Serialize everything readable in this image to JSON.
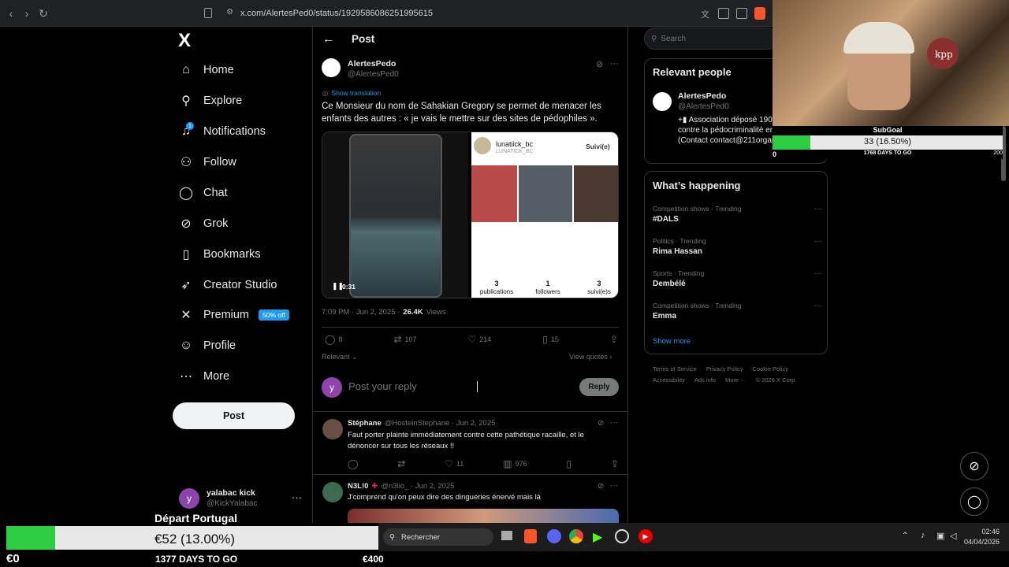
{
  "browser": {
    "url": "x.com/AlertesPed0/status/1929586086251995615"
  },
  "sidebar": {
    "logo": "X",
    "items": [
      {
        "label": "Home",
        "icon": "home-icon",
        "glyph": "⌂"
      },
      {
        "label": "Explore",
        "icon": "search-icon",
        "glyph": "⚲"
      },
      {
        "label": "Notifications",
        "icon": "bell-icon",
        "glyph": "♫"
      },
      {
        "label": "Follow",
        "icon": "add-person-icon",
        "glyph": "⚇"
      },
      {
        "label": "Chat",
        "icon": "chat-icon",
        "glyph": "◯"
      },
      {
        "label": "Grok",
        "icon": "grok-icon",
        "glyph": "⊘"
      },
      {
        "label": "Bookmarks",
        "icon": "bookmark-icon",
        "glyph": "▯"
      },
      {
        "label": "Creator Studio",
        "icon": "rocket-icon",
        "glyph": "➶"
      },
      {
        "label": "Premium",
        "icon": "x-icon",
        "glyph": "✕"
      },
      {
        "label": "Profile",
        "icon": "person-icon",
        "glyph": "☺"
      },
      {
        "label": "More",
        "icon": "more-circle-icon",
        "glyph": "⋯"
      }
    ],
    "notifications_badge": "1",
    "premium_badge": "50% off",
    "post_button": "Post",
    "account": {
      "avatar_letter": "y",
      "name": "yalabac kick",
      "handle": "@KickYalabac"
    }
  },
  "main": {
    "header_title": "Post",
    "post": {
      "author_name": "AlertesPedo",
      "author_handle": "@AlertesPed0",
      "show_translation": "Show translation",
      "text": "Ce Monsieur du nom de Sahakian Gregory se permet de menacer les enfants des autres : « je vais le mettre sur des sites de pédophiles ».",
      "video_time": "0:31",
      "profile_shot": {
        "name": "lunatiick_bc",
        "handle": "LUNATICK_BC",
        "button": "Suivi(e)",
        "stats": [
          {
            "value": "3",
            "label": "publications"
          },
          {
            "value": "1",
            "label": "followers"
          },
          {
            "value": "3",
            "label": "suivi(e)s"
          }
        ]
      },
      "timestamp": "7:09 PM · Jun 2, 2025 ·",
      "views_count": "26.4K",
      "views_label": "Views",
      "replies": "8",
      "reposts": "107",
      "likes": "214",
      "bookmarks": "15",
      "sort_label": "Relevant",
      "view_quotes": "View quotes"
    },
    "reply_box": {
      "avatar_letter": "y",
      "placeholder": "Post your reply",
      "button": "Reply"
    },
    "replies": [
      {
        "name": "Stéphane",
        "handle": "@HosteinStephane · Jun 2, 2025",
        "text": "Faut porter plainte immédiatement contre cette pathétique racaille, et le dénoncer sur tous les réseaux !!",
        "likes": "11",
        "views": "976"
      },
      {
        "name": "N3L!0",
        "handle": "@n3lio_ · Jun 2, 2025",
        "text": "J'comprend qu'on peux dire des dingueries énervé mais là"
      }
    ]
  },
  "right": {
    "search_placeholder": "Search",
    "relevant": {
      "title": "Relevant people",
      "name": "AlertesPedo",
      "handle": "@AlertesPed0",
      "bio": "+▮ Association déposé 1901 qui lutte contre la pédocriminalité en France. (Contact contact@211organisation.com)"
    },
    "happening": {
      "title": "What’s happening",
      "trends": [
        {
          "category": "Competition shows · Trending",
          "name": "#DALS"
        },
        {
          "category": "Politics · Trending",
          "name": "Rima Hassan"
        },
        {
          "category": "Sports · Trending",
          "name": "Dembélé"
        },
        {
          "category": "Competition shows · Trending",
          "name": "Emma"
        }
      ],
      "show_more": "Show more"
    },
    "footer": [
      "Terms of Service",
      "Privacy Policy",
      "Cookie Policy",
      "Accessibility",
      "Ads info",
      "More ···",
      "© 2026 X Corp."
    ]
  },
  "overlay_subgoal": {
    "title": "SubGoal",
    "value": "33 (16.50%)",
    "progress_percent": 16.5,
    "min": "0",
    "max": "200",
    "days": "1768 DAYS TO GO"
  },
  "overlay_goal": {
    "title": "Départ Portugal",
    "value": "€52 (13.00%)",
    "progress_percent": 13,
    "min": "€0",
    "max": "€400",
    "days": "1377 DAYS TO GO"
  },
  "taskbar": {
    "search": "Rechercher",
    "time": "02:46",
    "date": "04/04/2026"
  },
  "colors": {
    "accent": "#1d9bf0",
    "progress": "#2ecc40",
    "bg": "#000000"
  }
}
